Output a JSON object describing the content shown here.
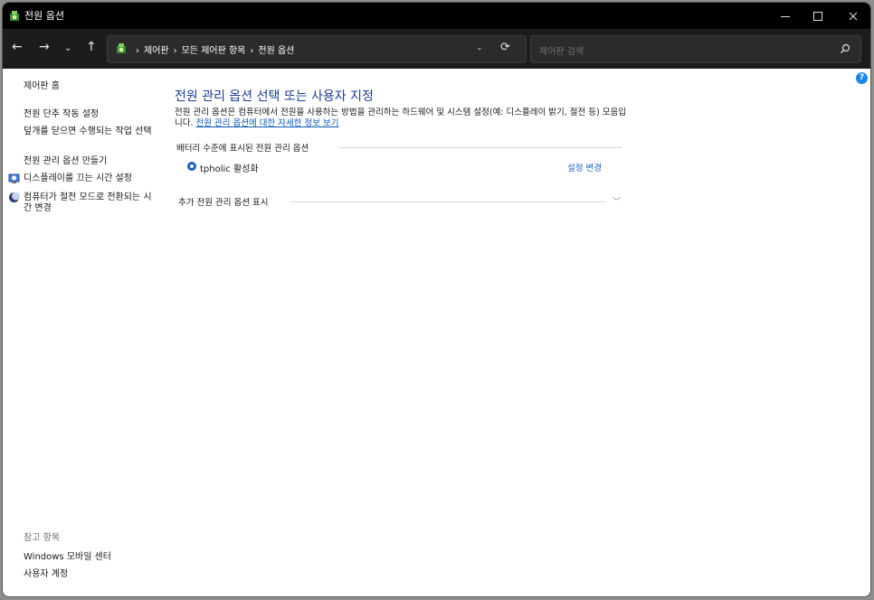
{
  "window": {
    "title": "전원 옵션"
  },
  "navbar": {
    "back_glyph": "←",
    "forward_glyph": "→",
    "recent_glyph": "⌄",
    "up_glyph": "↑",
    "breadcrumb": [
      "제어판",
      "모든 제어판 항목",
      "전원 옵션"
    ],
    "breadcrumb_sep": "›",
    "dropdown_glyph": "⌄",
    "refresh_glyph": "⟳"
  },
  "search": {
    "placeholder": "제어판 검색"
  },
  "leftpane": {
    "home": "제어판 홈",
    "tasks": [
      "전원 단추 작동 설정",
      "덮개를 닫으면 수행되는 작업 선택",
      "전원 관리 옵션 만들기",
      "디스플레이를 끄는 시간 설정",
      "컴퓨터가 절전 모드로 전환되는 시간 변경"
    ],
    "see_also": "참고 항목",
    "see_also_links": [
      "Windows 모바일 센터",
      "사용자 계정"
    ]
  },
  "main": {
    "heading": "전원 관리 옵션 선택 또는 사용자 지정",
    "description": "전원 관리 옵션은 컴퓨터에서 전원을 사용하는 방법을 관리하는 하드웨어 및 시스템 설정(예: 디스플레이 밝기, 절전 등) 모음입니다.",
    "description_link": "전원 관리 옵션에 대한 자세한 정보 보기",
    "group_label": "배터리 수준에 표시된 전원 관리 옵션",
    "plan_name": "tpholic 활성화",
    "plan_change": "설정 변경",
    "more_label": "추가 전원 관리 옵션 표시",
    "more_chevron": "﹀"
  },
  "help": {
    "glyph": "?"
  },
  "colors": {
    "accent": "#1b5fc1",
    "heading": "#1e3d8f",
    "link": "#0a58b8",
    "titlebar": "#000000",
    "navbar": "#1c1c1c"
  }
}
